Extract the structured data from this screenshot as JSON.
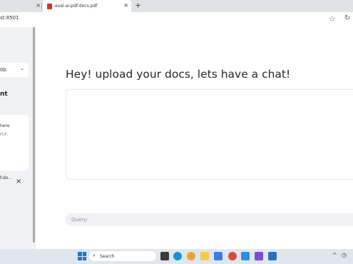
{
  "browser": {
    "tabs": [
      {
        "label": ""
      },
      {
        "label": "eval-ai-pdf-docs.pdf"
      }
    ],
    "close_glyph": "×",
    "new_tab_glyph": "+",
    "address": "st:8501",
    "star_glyph": "☆",
    "reload_glyph": "↻"
  },
  "sidebar": {
    "model_select_value": "0b",
    "chevron_glyph": "⌄",
    "heading": "nt",
    "upload_card_line1": "here",
    "upload_card_line2": "PDF,",
    "file_name": "f-do...",
    "file_remove_glyph": "×"
  },
  "main": {
    "title": "Hey! upload your docs, lets have a chat!",
    "query_placeholder": "Query:"
  },
  "taskbar": {
    "search_label": "Search",
    "search_glyph": "⌕",
    "tray_caret": "^",
    "clock_glyph": "◷"
  },
  "colors": {
    "sidebar_bg": "#f0f2f6",
    "accent_line": "#f2b7a4",
    "pdf_icon": "#d93025",
    "taskbar_bg": "#dfe6ee"
  }
}
